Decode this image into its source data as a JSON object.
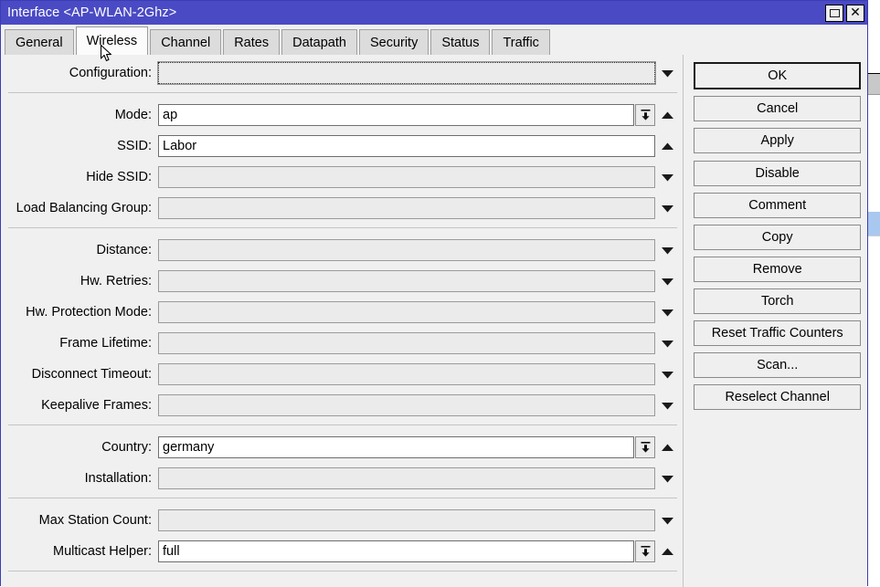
{
  "window": {
    "title": "Interface <AP-WLAN-2Ghz>",
    "controls": [
      {
        "name": "restore",
        "glyph": "restore-icon"
      },
      {
        "name": "close",
        "glyph": "close-icon"
      }
    ]
  },
  "tabs": [
    {
      "label": "General",
      "active": false
    },
    {
      "label": "Wireless",
      "active": true
    },
    {
      "label": "Channel",
      "active": false
    },
    {
      "label": "Rates",
      "active": false
    },
    {
      "label": "Datapath",
      "active": false
    },
    {
      "label": "Security",
      "active": false
    },
    {
      "label": "Status",
      "active": false
    },
    {
      "label": "Traffic",
      "active": false
    }
  ],
  "form": {
    "groups": [
      {
        "rows": [
          {
            "label": "Configuration:",
            "value": "",
            "focused": true,
            "combo": false,
            "arrow": "down"
          }
        ]
      },
      {
        "rows": [
          {
            "label": "Mode:",
            "value": "ap",
            "focused": false,
            "combo": true,
            "arrow": "up"
          },
          {
            "label": "SSID:",
            "value": "Labor",
            "focused": false,
            "combo": false,
            "arrow": "up"
          },
          {
            "label": "Hide SSID:",
            "value": "",
            "focused": false,
            "combo": false,
            "arrow": "down"
          },
          {
            "label": "Load Balancing Group:",
            "value": "",
            "focused": false,
            "combo": false,
            "arrow": "down"
          }
        ]
      },
      {
        "rows": [
          {
            "label": "Distance:",
            "value": "",
            "focused": false,
            "combo": false,
            "arrow": "down"
          },
          {
            "label": "Hw. Retries:",
            "value": "",
            "focused": false,
            "combo": false,
            "arrow": "down"
          },
          {
            "label": "Hw. Protection Mode:",
            "value": "",
            "focused": false,
            "combo": false,
            "arrow": "down"
          },
          {
            "label": "Frame Lifetime:",
            "value": "",
            "focused": false,
            "combo": false,
            "arrow": "down"
          },
          {
            "label": "Disconnect Timeout:",
            "value": "",
            "focused": false,
            "combo": false,
            "arrow": "down"
          },
          {
            "label": "Keepalive Frames:",
            "value": "",
            "focused": false,
            "combo": false,
            "arrow": "down"
          }
        ]
      },
      {
        "rows": [
          {
            "label": "Country:",
            "value": "germany",
            "focused": false,
            "combo": true,
            "arrow": "up"
          },
          {
            "label": "Installation:",
            "value": "",
            "focused": false,
            "combo": false,
            "arrow": "down"
          }
        ]
      },
      {
        "rows": [
          {
            "label": "Max Station Count:",
            "value": "",
            "focused": false,
            "combo": false,
            "arrow": "down"
          },
          {
            "label": "Multicast Helper:",
            "value": "full",
            "focused": false,
            "combo": true,
            "arrow": "up"
          }
        ]
      }
    ]
  },
  "buttons": [
    {
      "label": "OK",
      "style": "default",
      "gap": false
    },
    {
      "label": "Cancel",
      "style": "normal",
      "gap": false
    },
    {
      "label": "Apply",
      "style": "normal",
      "gap": false
    },
    {
      "label": "Disable",
      "style": "normal",
      "gap": true
    },
    {
      "label": "Comment",
      "style": "normal",
      "gap": false
    },
    {
      "label": "Copy",
      "style": "normal",
      "gap": false
    },
    {
      "label": "Remove",
      "style": "normal",
      "gap": false
    },
    {
      "label": "Torch",
      "style": "normal",
      "gap": false
    },
    {
      "label": "Reset Traffic Counters",
      "style": "normal",
      "gap": false
    },
    {
      "label": "Scan...",
      "style": "normal",
      "gap": false
    },
    {
      "label": "Reselect Channel",
      "style": "normal",
      "gap": false
    }
  ],
  "colors": {
    "titlebar": "#4a4ac4",
    "dialog_face": "#f0f0f0",
    "tab_inactive": "#dcdcdc",
    "tab_active": "#fbfbfb",
    "field_disabled": "#ebebeb",
    "field_enabled": "#ffffff",
    "selection_blue": "#a8c8f0"
  },
  "background_window": {
    "visible_sliver": true
  }
}
